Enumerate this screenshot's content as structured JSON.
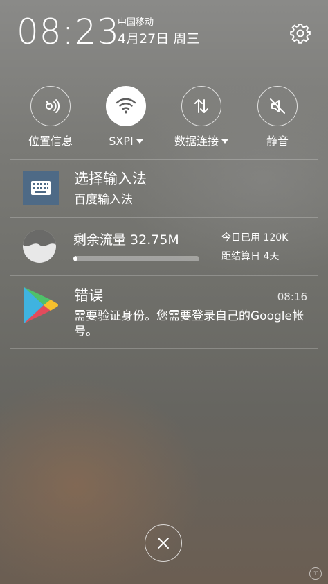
{
  "status_bar": {
    "time": "08:23",
    "carrier": "中国移动",
    "date": "4月27日 周三"
  },
  "quick_toggles": [
    {
      "label": "位置信息",
      "icon": "location-icon",
      "active": false,
      "has_dropdown": false
    },
    {
      "label": "SXPI",
      "icon": "wifi-icon",
      "active": true,
      "has_dropdown": true
    },
    {
      "label": "数据连接",
      "icon": "data-transfer-icon",
      "active": false,
      "has_dropdown": true
    },
    {
      "label": "静音",
      "icon": "mute-icon",
      "active": false,
      "has_dropdown": false
    }
  ],
  "notifications": {
    "input_method": {
      "title": "选择输入法",
      "subtitle": "百度输入法",
      "icon": "keyboard-icon",
      "icon_bg": "#4e6a86"
    },
    "data_usage": {
      "title": "剩余流量 32.75M",
      "progress_fraction": 0.03,
      "used_today": "今日已用 120K",
      "days_to_billing": "距结算日 4天"
    },
    "error": {
      "title": "错误",
      "time": "08:16",
      "message": "需要验证身份。您需要登录自己的Google帐号。",
      "icon": "google-play-icon"
    }
  },
  "clear_button": {
    "icon": "close-icon"
  },
  "watermark": {
    "text": "m"
  }
}
